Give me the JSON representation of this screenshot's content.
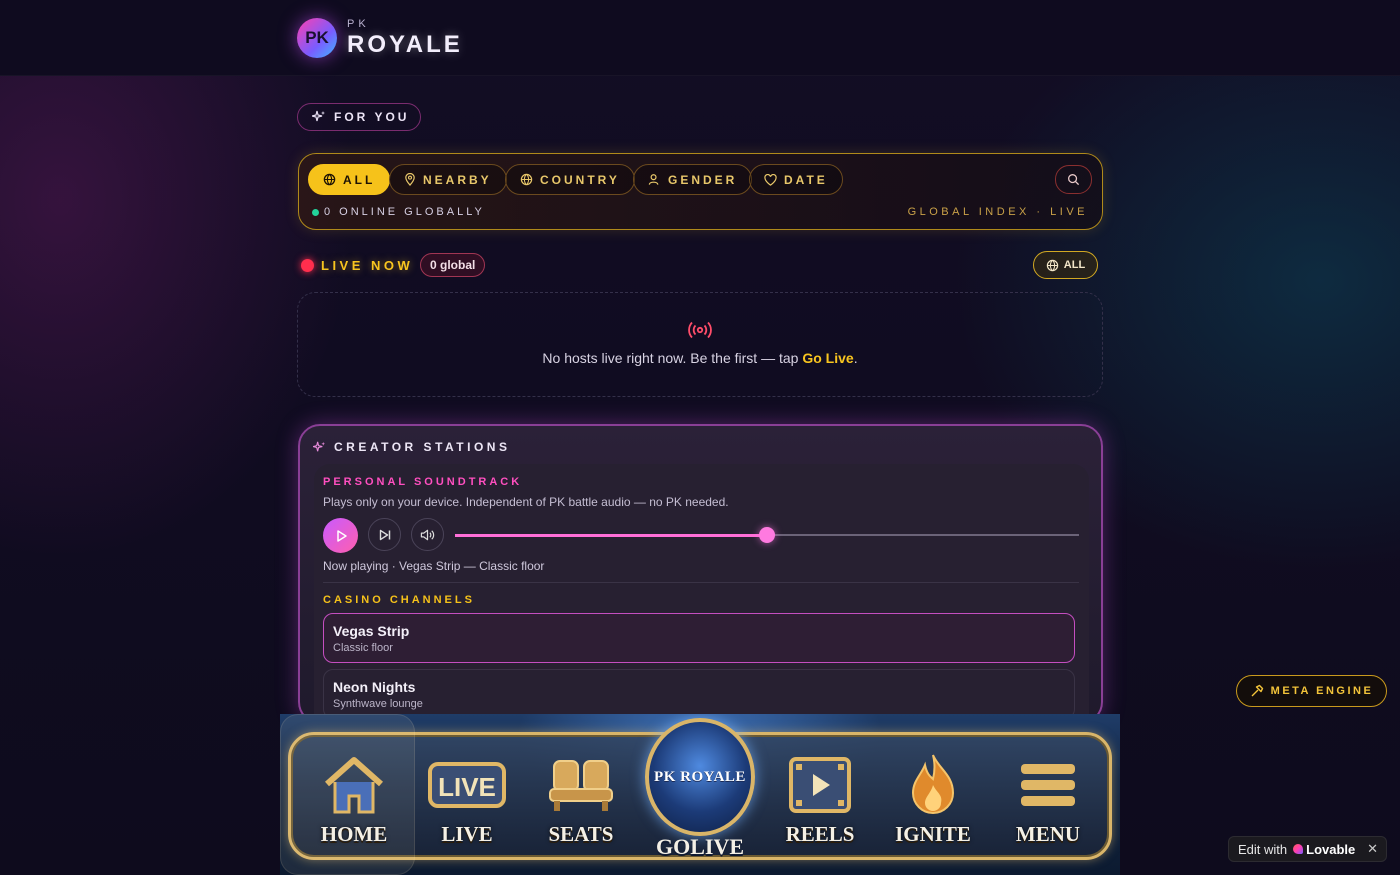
{
  "brand": {
    "small": "PK",
    "big": "ROYALE",
    "badge": "PK"
  },
  "for_you": {
    "label": "FOR YOU"
  },
  "filters": {
    "chips": [
      {
        "label": "ALL",
        "icon": "globe-icon",
        "active": true
      },
      {
        "label": "NEARBY",
        "icon": "pin-icon",
        "active": false
      },
      {
        "label": "COUNTRY",
        "icon": "globe-icon",
        "active": false
      },
      {
        "label": "GENDER",
        "icon": "users-icon",
        "active": false
      },
      {
        "label": "DATE",
        "icon": "heart-icon",
        "active": false
      }
    ],
    "online_text": "0 ONLINE GLOBALLY",
    "global_index": "GLOBAL INDEX · LIVE"
  },
  "live_now": {
    "title": "LIVE NOW",
    "badge": "0 global",
    "scope": "ALL",
    "empty_prefix": "No hosts live right now. Be the first — tap ",
    "empty_link": "Go Live",
    "empty_suffix": "."
  },
  "creator_stations": {
    "title": "CREATOR STATIONS",
    "soundtrack_title": "PERSONAL SOUNDTRACK",
    "soundtrack_desc": "Plays only on your device. Independent of PK battle audio — no PK needed.",
    "volume": 0.5,
    "now_playing": "Now playing · Vegas Strip — Classic floor",
    "casino_title": "CASINO CHANNELS",
    "channels": [
      {
        "name": "Vegas Strip",
        "sub": "Classic floor",
        "selected": true
      },
      {
        "name": "Neon Nights",
        "sub": "Synthwave lounge",
        "selected": false
      }
    ]
  },
  "meta_engine": {
    "label": "META ENGINE"
  },
  "nav": {
    "items": [
      {
        "label": "HOME",
        "icon": "home-icon"
      },
      {
        "label": "LIVE",
        "icon": "live-icon"
      },
      {
        "label": "SEATS",
        "icon": "seats-icon"
      },
      {
        "label": "REELS",
        "icon": "reels-icon"
      },
      {
        "label": "IGNITE",
        "icon": "flame-icon"
      },
      {
        "label": "MENU",
        "icon": "menu-icon"
      }
    ],
    "golive_label": "GOLIVE",
    "golive_emblem": "PK ROYALE"
  },
  "lovable": {
    "edit_label": "Edit with",
    "brand": "Lovable",
    "close": "✕"
  },
  "colors": {
    "gold": "#f6c21a",
    "pink": "#ff4fc0",
    "live_red": "#ff2e4d",
    "online_green": "#22d39a"
  }
}
